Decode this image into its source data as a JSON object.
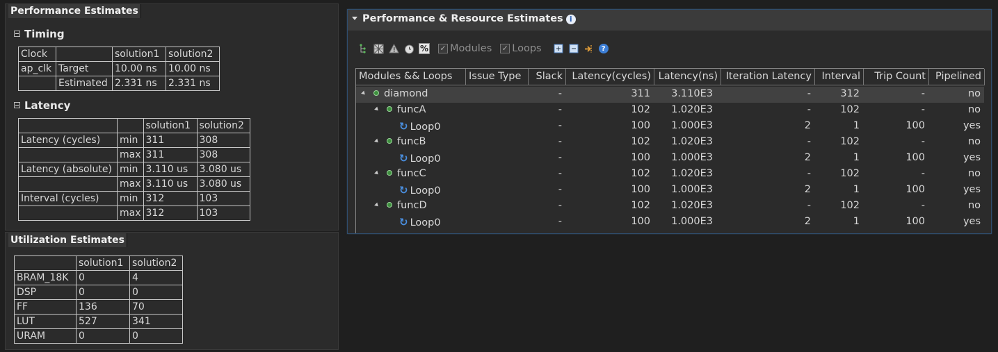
{
  "perf": {
    "title": "Performance Estimates",
    "timing": {
      "title": "Timing",
      "rows": [
        [
          "Clock",
          "",
          "solution1",
          "solution2"
        ],
        [
          "ap_clk",
          "Target",
          "10.00 ns",
          "10.00 ns"
        ],
        [
          "",
          "Estimated",
          "2.331 ns",
          "2.331 ns"
        ]
      ]
    },
    "latency": {
      "title": "Latency",
      "rows": [
        [
          "",
          "",
          "solution1",
          "solution2"
        ],
        [
          "Latency (cycles)",
          "min",
          "311",
          "308"
        ],
        [
          "",
          "max",
          "311",
          "308"
        ],
        [
          "Latency (absolute)",
          "min",
          "3.110 us",
          "3.080 us"
        ],
        [
          "",
          "max",
          "3.110 us",
          "3.080 us"
        ],
        [
          "Interval (cycles)",
          "min",
          "312",
          "103"
        ],
        [
          "",
          "max",
          "312",
          "103"
        ]
      ]
    }
  },
  "util": {
    "title": "Utilization Estimates",
    "rows": [
      [
        "",
        "solution1",
        "solution2"
      ],
      [
        "BRAM_18K",
        "0",
        "4"
      ],
      [
        "DSP",
        "0",
        "0"
      ],
      [
        "FF",
        "136",
        "70"
      ],
      [
        "LUT",
        "527",
        "341"
      ],
      [
        "URAM",
        "0",
        "0"
      ]
    ]
  },
  "estimates": {
    "title": "Performance & Resource Estimates",
    "info_icon": "i",
    "toolbar": {
      "modules_label": "Modules",
      "loops_label": "Loops",
      "percent_label": "%",
      "help_label": "?"
    },
    "columns": [
      "Modules && Loops",
      "Issue Type",
      "Slack",
      "Latency(cycles)",
      "Latency(ns)",
      "Iteration Latency",
      "Interval",
      "Trip Count",
      "Pipelined"
    ],
    "rows": [
      {
        "name": "diamond",
        "kind": "top",
        "issue": "",
        "slack": "-",
        "lat_cycles": "311",
        "lat_ns": "3.110E3",
        "iter_lat": "-",
        "interval": "312",
        "trip": "-",
        "pipelined": "no"
      },
      {
        "name": "funcA",
        "kind": "func",
        "issue": "",
        "slack": "-",
        "lat_cycles": "102",
        "lat_ns": "1.020E3",
        "iter_lat": "-",
        "interval": "102",
        "trip": "-",
        "pipelined": "no"
      },
      {
        "name": "Loop0",
        "kind": "loop",
        "issue": "",
        "slack": "-",
        "lat_cycles": "100",
        "lat_ns": "1.000E3",
        "iter_lat": "2",
        "interval": "1",
        "trip": "100",
        "pipelined": "yes"
      },
      {
        "name": "funcB",
        "kind": "func",
        "issue": "",
        "slack": "-",
        "lat_cycles": "102",
        "lat_ns": "1.020E3",
        "iter_lat": "-",
        "interval": "102",
        "trip": "-",
        "pipelined": "no"
      },
      {
        "name": "Loop0",
        "kind": "loop",
        "issue": "",
        "slack": "-",
        "lat_cycles": "100",
        "lat_ns": "1.000E3",
        "iter_lat": "2",
        "interval": "1",
        "trip": "100",
        "pipelined": "yes"
      },
      {
        "name": "funcC",
        "kind": "func",
        "issue": "",
        "slack": "-",
        "lat_cycles": "102",
        "lat_ns": "1.020E3",
        "iter_lat": "-",
        "interval": "102",
        "trip": "-",
        "pipelined": "no"
      },
      {
        "name": "Loop0",
        "kind": "loop",
        "issue": "",
        "slack": "-",
        "lat_cycles": "100",
        "lat_ns": "1.000E3",
        "iter_lat": "2",
        "interval": "1",
        "trip": "100",
        "pipelined": "yes"
      },
      {
        "name": "funcD",
        "kind": "func",
        "issue": "",
        "slack": "-",
        "lat_cycles": "102",
        "lat_ns": "1.020E3",
        "iter_lat": "-",
        "interval": "102",
        "trip": "-",
        "pipelined": "no"
      },
      {
        "name": "Loop0",
        "kind": "loop",
        "issue": "",
        "slack": "-",
        "lat_cycles": "100",
        "lat_ns": "1.000E3",
        "iter_lat": "2",
        "interval": "1",
        "trip": "100",
        "pipelined": "yes"
      }
    ]
  }
}
